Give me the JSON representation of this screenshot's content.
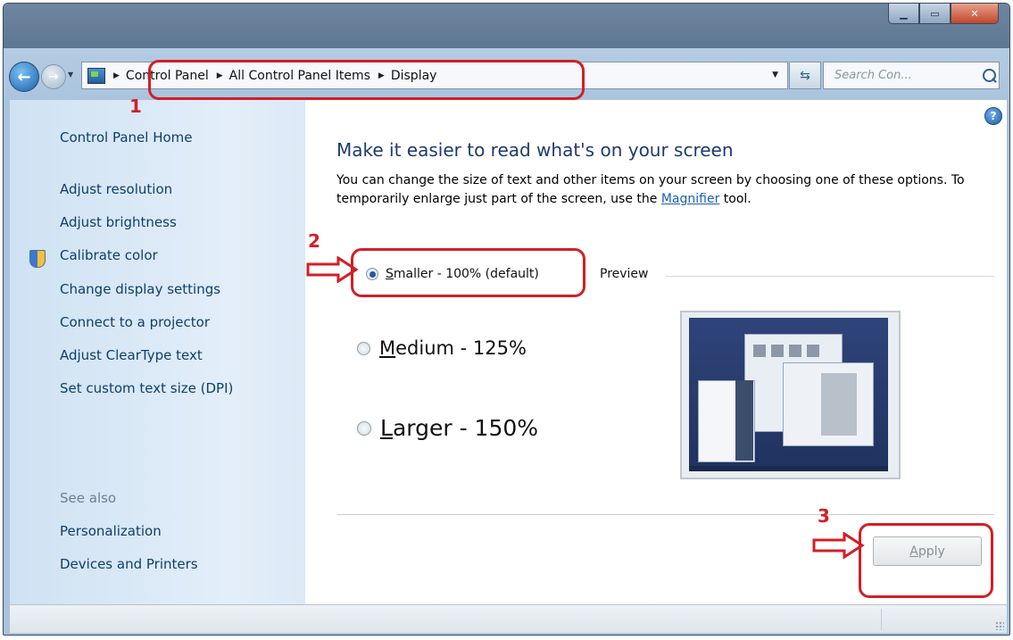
{
  "window": {
    "caption": {
      "minimize": "▁",
      "maximize": "▭",
      "close": "✕"
    }
  },
  "address": {
    "crumbs": [
      "Control Panel",
      "All Control Panel Items",
      "Display"
    ],
    "search_placeholder": "Search Con..."
  },
  "sidebar": {
    "home": "Control Panel Home",
    "links": [
      "Adjust resolution",
      "Adjust brightness",
      "Calibrate color",
      "Change display settings",
      "Connect to a projector",
      "Adjust ClearType text",
      "Set custom text size (DPI)"
    ],
    "see_also": "See also",
    "see_also_links": [
      "Personalization",
      "Devices and Printers"
    ]
  },
  "main": {
    "help": "?",
    "title": "Make it easier to read what's on your screen",
    "description_pre": "You can change the size of text and other items on your screen by choosing one of these options. To temporarily enlarge just part of the screen, use the ",
    "description_link": "Magnifier",
    "description_post": " tool.",
    "options": [
      {
        "accel": "S",
        "rest": "maller - 100% (default)",
        "checked": true
      },
      {
        "accel": "M",
        "rest": "edium - 125%",
        "checked": false
      },
      {
        "accel": "L",
        "rest": "arger - 150%",
        "checked": false
      }
    ],
    "preview_label": "Preview",
    "apply": {
      "accel": "A",
      "rest": "pply"
    }
  },
  "annotations": {
    "labels": [
      "1",
      "2",
      "3"
    ],
    "color": "#d21f26"
  }
}
